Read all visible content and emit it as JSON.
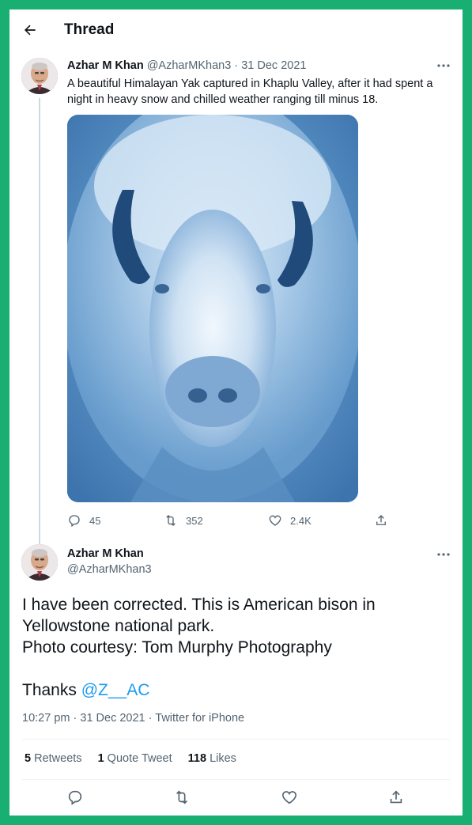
{
  "header": {
    "back_icon": "arrow-left-icon",
    "title": "Thread"
  },
  "tweet1": {
    "author_name": "Azhar M Khan",
    "author_handle": "@AzharMKhan3",
    "separator": "·",
    "date": "31 Dec 2021",
    "text": "A beautiful Himalayan Yak captured in Khaplu Valley, after it had spent a night in heavy snow and chilled weather ranging till minus 18.",
    "media_icon": "frozen-bison-photo",
    "actions": {
      "replies": "45",
      "retweets": "352",
      "likes": "2.4K"
    }
  },
  "tweet2": {
    "author_name": "Azhar M Khan",
    "author_handle": "@AzharMKhan3",
    "line1": "I have been corrected. This is American bison in Yellowstone national park.",
    "line2": "Photo courtesy: Tom Murphy Photography",
    "thanks_prefix": "Thanks ",
    "mention": "@Z__AC",
    "time": "10:27 pm",
    "date": "31 Dec 2021",
    "source": "Twitter for iPhone",
    "meta_sep": "·",
    "stats": {
      "retweets_count": "5",
      "retweets_label": "Retweets",
      "quotes_count": "1",
      "quotes_label": "Quote Tweet",
      "likes_count": "118",
      "likes_label": "Likes"
    }
  },
  "colors": {
    "border_green": "#1aaf72",
    "link_blue": "#1d9bf0",
    "muted_gray": "#536471"
  }
}
